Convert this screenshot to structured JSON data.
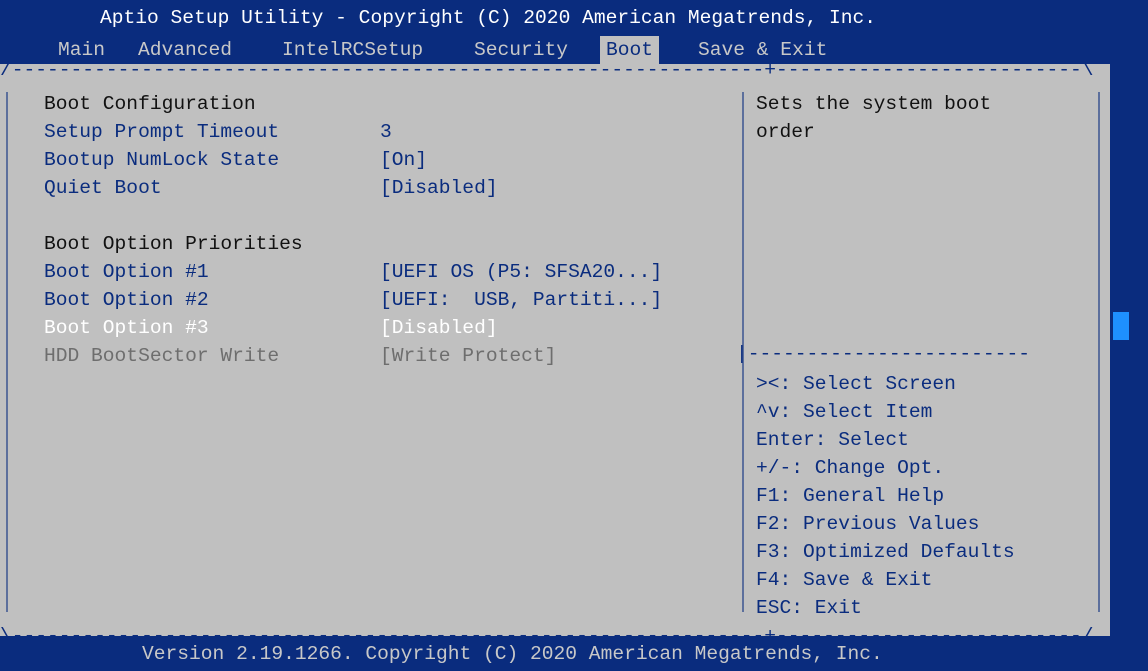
{
  "header": {
    "title": "Aptio Setup Utility - Copyright (C) 2020 American Megatrends, Inc."
  },
  "tabs": [
    {
      "label": "Main",
      "active": false
    },
    {
      "label": "Advanced",
      "active": false
    },
    {
      "label": "IntelRCSetup",
      "active": false
    },
    {
      "label": "Security",
      "active": false
    },
    {
      "label": "Boot",
      "active": true
    },
    {
      "label": "Save & Exit",
      "active": false
    }
  ],
  "borders": {
    "top": "/----------------------------------------------------------------+--------------------------\\",
    "mid": "|------------------------",
    "bottom": "\\----------------------------------------------------------------+--------------------------/"
  },
  "settings": {
    "section_boot_config": "Boot Configuration",
    "setup_prompt_label": "Setup Prompt Timeout",
    "setup_prompt_value": "3",
    "numlock_label": "Bootup NumLock State",
    "numlock_value": "[On]",
    "quiet_boot_label": "Quiet Boot",
    "quiet_boot_value": "[Disabled]",
    "section_priorities": "Boot Option Priorities",
    "boot1_label": "Boot Option #1",
    "boot1_value": "[UEFI OS (P5: SFSA20...]",
    "boot2_label": "Boot Option #2",
    "boot2_value": "[UEFI:  USB, Partiti...]",
    "boot3_label": "Boot Option #3",
    "boot3_value": "[Disabled]",
    "hdd_label": "HDD BootSector Write",
    "hdd_value": "[Write Protect]"
  },
  "help": {
    "line1": "Sets the system boot",
    "line2": "order"
  },
  "keys": [
    "><: Select Screen",
    "^v: Select Item",
    "Enter: Select",
    "+/-: Change Opt.",
    "F1: General Help",
    "F2: Previous Values",
    "F3: Optimized Defaults",
    "F4: Save & Exit",
    "ESC: Exit"
  ],
  "footer": {
    "text": "Version 2.19.1266. Copyright (C) 2020 American Megatrends, Inc."
  },
  "colors": {
    "background": "#0a2c7e",
    "panel": "#c0c0c0",
    "highlight": "#ffffff",
    "scroll_indicator": "#1e90ff"
  }
}
